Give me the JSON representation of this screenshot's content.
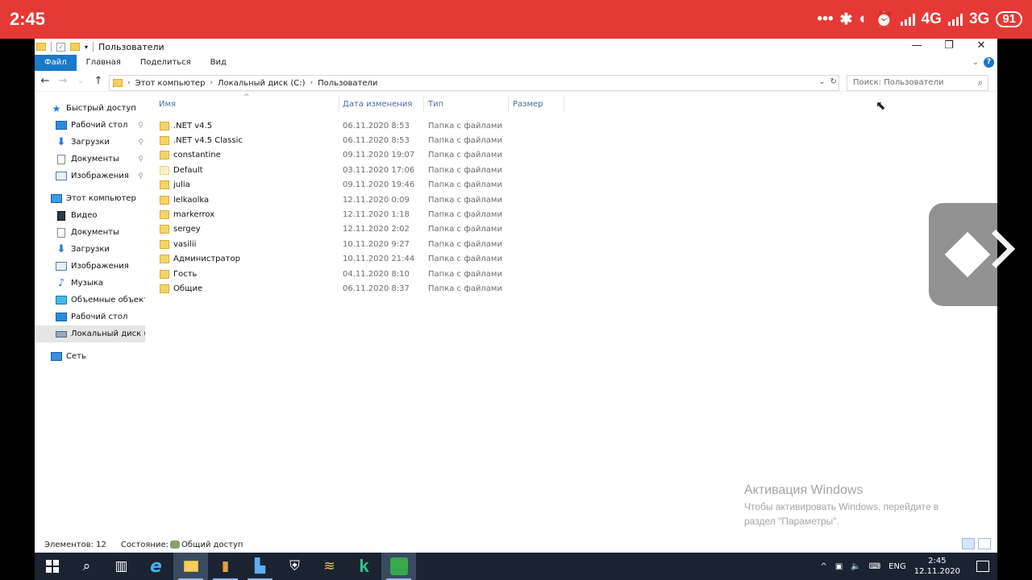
{
  "phone_status": {
    "time": "2:45",
    "dots": "•••",
    "network1": "4G",
    "network2": "3G",
    "battery": "91"
  },
  "window": {
    "title": "Пользователи",
    "controls": [
      "—",
      "❐",
      "✕"
    ]
  },
  "ribbon": {
    "tabs": [
      "Файл",
      "Главная",
      "Поделиться",
      "Вид"
    ]
  },
  "address": {
    "crumbs": [
      "Этот компьютер",
      "Локальный диск (C:)",
      "Пользователи"
    ],
    "search_placeholder": "Поиск: Пользователи"
  },
  "navpane": {
    "items": [
      {
        "label": "Быстрый доступ",
        "icon": "star-icon",
        "indent": 0,
        "pinned": false,
        "selected": false
      },
      {
        "label": "Рабочий стол",
        "icon": "desktop-icon",
        "indent": 1,
        "pinned": true,
        "selected": false
      },
      {
        "label": "Загрузки",
        "icon": "download-icon",
        "indent": 1,
        "pinned": true,
        "selected": false
      },
      {
        "label": "Документы",
        "icon": "document-icon",
        "indent": 1,
        "pinned": true,
        "selected": false
      },
      {
        "label": "Изображения",
        "icon": "pictures-icon",
        "indent": 1,
        "pinned": true,
        "selected": false
      },
      {
        "label": "Этот компьютер",
        "icon": "computer-icon",
        "indent": 0,
        "pinned": false,
        "selected": false
      },
      {
        "label": "Видео",
        "icon": "video-icon",
        "indent": 1,
        "pinned": false,
        "selected": false
      },
      {
        "label": "Документы",
        "icon": "document-icon",
        "indent": 1,
        "pinned": false,
        "selected": false
      },
      {
        "label": "Загрузки",
        "icon": "download-icon",
        "indent": 1,
        "pinned": false,
        "selected": false
      },
      {
        "label": "Изображения",
        "icon": "pictures-icon",
        "indent": 1,
        "pinned": false,
        "selected": false
      },
      {
        "label": "Музыка",
        "icon": "music-icon",
        "indent": 1,
        "pinned": false,
        "selected": false
      },
      {
        "label": "Объемные объекты",
        "icon": "3d-objects-icon",
        "indent": 1,
        "pinned": false,
        "selected": false
      },
      {
        "label": "Рабочий стол",
        "icon": "desktop-icon",
        "indent": 1,
        "pinned": false,
        "selected": false
      },
      {
        "label": "Локальный диск (C:)",
        "icon": "disk-icon",
        "indent": 1,
        "pinned": false,
        "selected": true
      },
      {
        "label": "Сеть",
        "icon": "network-icon",
        "indent": 0,
        "pinned": false,
        "selected": false
      }
    ]
  },
  "columns": [
    "Имя",
    "Дата изменения",
    "Тип",
    "Размер"
  ],
  "files": [
    {
      "name": ".NET v4.5",
      "date": "06.11.2020 8:53",
      "type": "Папка с файлами",
      "light": false
    },
    {
      "name": ".NET v4.5 Classic",
      "date": "06.11.2020 8:53",
      "type": "Папка с файлами",
      "light": false
    },
    {
      "name": "constantine",
      "date": "09.11.2020 19:07",
      "type": "Папка с файлами",
      "light": false
    },
    {
      "name": "Default",
      "date": "03.11.2020 17:06",
      "type": "Папка с файлами",
      "light": true
    },
    {
      "name": "julia",
      "date": "09.11.2020 19:46",
      "type": "Папка с файлами",
      "light": false
    },
    {
      "name": "lelkaolka",
      "date": "12.11.2020 0:09",
      "type": "Папка с файлами",
      "light": false
    },
    {
      "name": "markerrox",
      "date": "12.11.2020 1:18",
      "type": "Папка с файлами",
      "light": false
    },
    {
      "name": "sergey",
      "date": "12.11.2020 2:02",
      "type": "Папка с файлами",
      "light": false
    },
    {
      "name": "vasilii",
      "date": "10.11.2020 9:27",
      "type": "Папка с файлами",
      "light": false
    },
    {
      "name": "Администратор",
      "date": "10.11.2020 21:44",
      "type": "Папка с файлами",
      "light": false
    },
    {
      "name": "Гость",
      "date": "04.11.2020 8:10",
      "type": "Папка с файлами",
      "light": false
    },
    {
      "name": "Общие",
      "date": "06.11.2020 8:37",
      "type": "Папка с файлами",
      "light": false
    }
  ],
  "statusbar": {
    "count": "Элементов: 12",
    "state_label": "Состояние:",
    "state_value": "Общий доступ"
  },
  "activation": {
    "title": "Активация Windows",
    "subtitle": "Чтобы активировать Windows, перейдите в раздел \"Параметры\"."
  },
  "taskbar": {
    "lang": "ENG",
    "time": "2:45",
    "date": "12.11.2020"
  }
}
